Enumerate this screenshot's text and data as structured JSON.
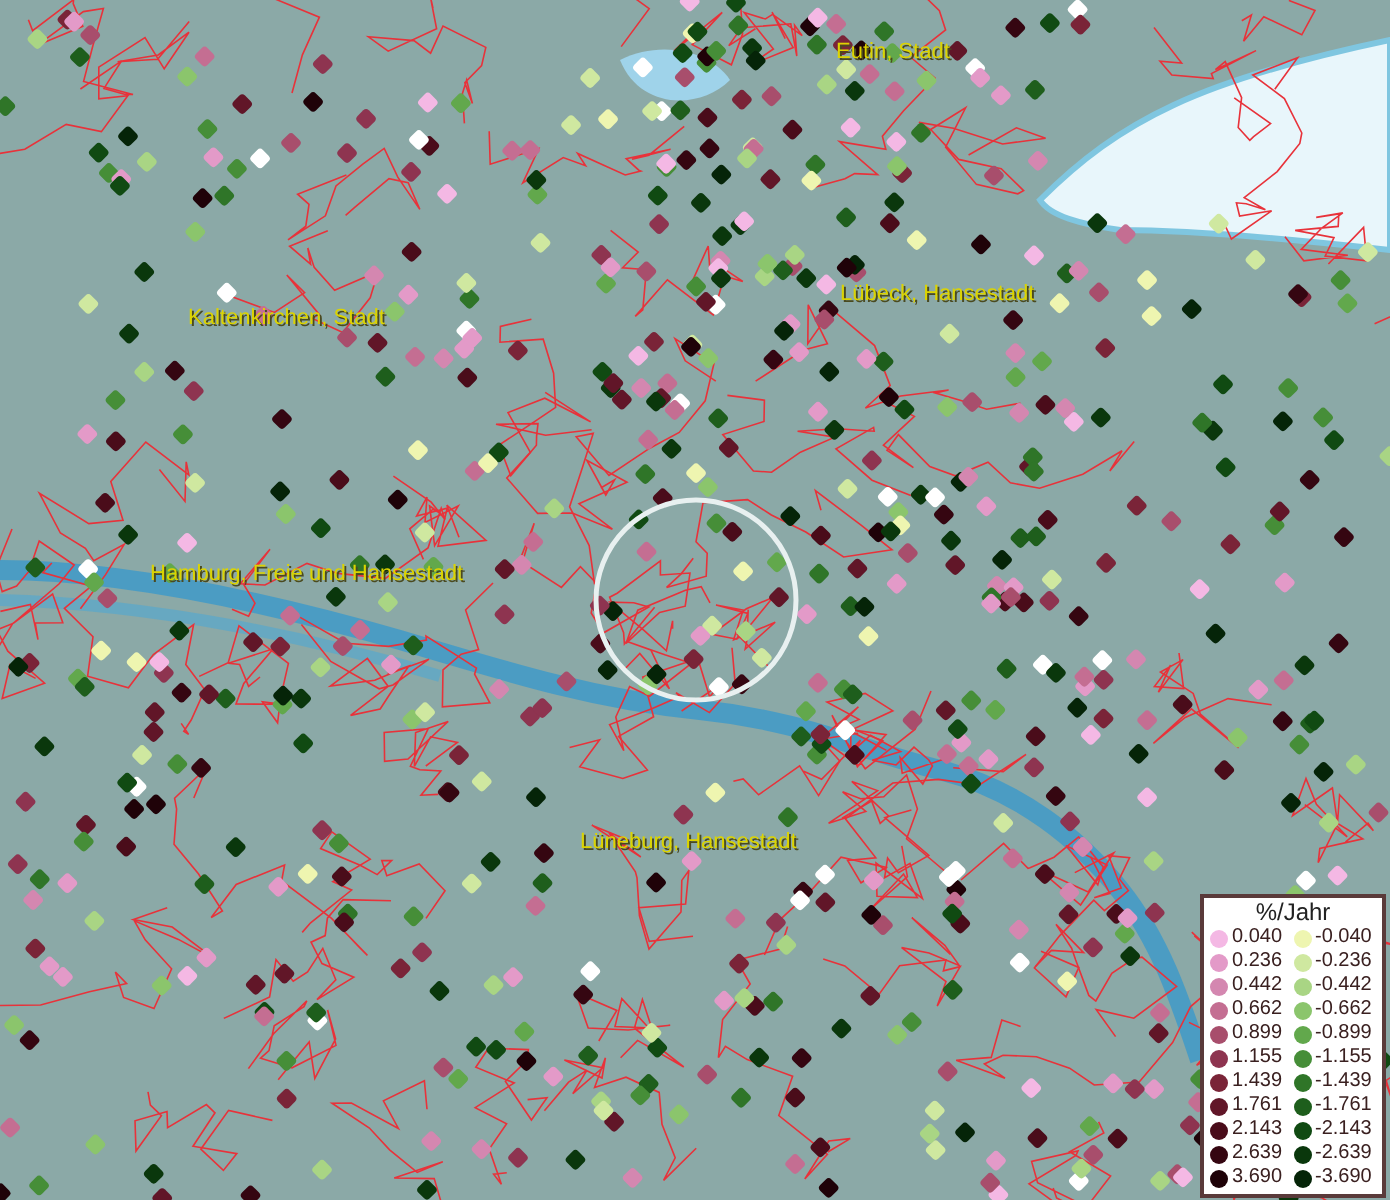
{
  "map": {
    "places": [
      {
        "name": "Eutin, Stadt"
      },
      {
        "name": "Kaltenkirchen, Stadt"
      },
      {
        "name": "Lübeck, Hansestadt"
      },
      {
        "name": "Hamburg, Freie und Hansestadt"
      },
      {
        "name": "Lüneburg, Hansestadt"
      }
    ]
  },
  "legend": {
    "title": "%/Jahr",
    "positive": [
      {
        "label": "0.040",
        "color": "#f4b8e4"
      },
      {
        "label": "0.236",
        "color": "#e39ac8"
      },
      {
        "label": "0.442",
        "color": "#d487b0"
      },
      {
        "label": "0.662",
        "color": "#c46e92"
      },
      {
        "label": "0.899",
        "color": "#a84e6c"
      },
      {
        "label": "1.155",
        "color": "#8e3450"
      },
      {
        "label": "1.439",
        "color": "#7a2438"
      },
      {
        "label": "1.761",
        "color": "#611628"
      },
      {
        "label": "2.143",
        "color": "#4a0c1a"
      },
      {
        "label": "2.639",
        "color": "#350611"
      },
      {
        "label": "3.690",
        "color": "#1f0208"
      }
    ],
    "negative": [
      {
        "label": "-0.040",
        "color": "#eef5b0"
      },
      {
        "label": "-0.236",
        "color": "#cfe8a0"
      },
      {
        "label": "-0.442",
        "color": "#a9d584"
      },
      {
        "label": "-0.662",
        "color": "#8bc56c"
      },
      {
        "label": "-0.899",
        "color": "#62a84c"
      },
      {
        "label": "-1.155",
        "color": "#468e38"
      },
      {
        "label": "-1.439",
        "color": "#2f7528"
      },
      {
        "label": "-1.761",
        "color": "#1e5e1c"
      },
      {
        "label": "-2.143",
        "color": "#104a12"
      },
      {
        "label": "-2.639",
        "color": "#0a370c"
      },
      {
        "label": "-3.690",
        "color": "#052408"
      }
    ]
  }
}
